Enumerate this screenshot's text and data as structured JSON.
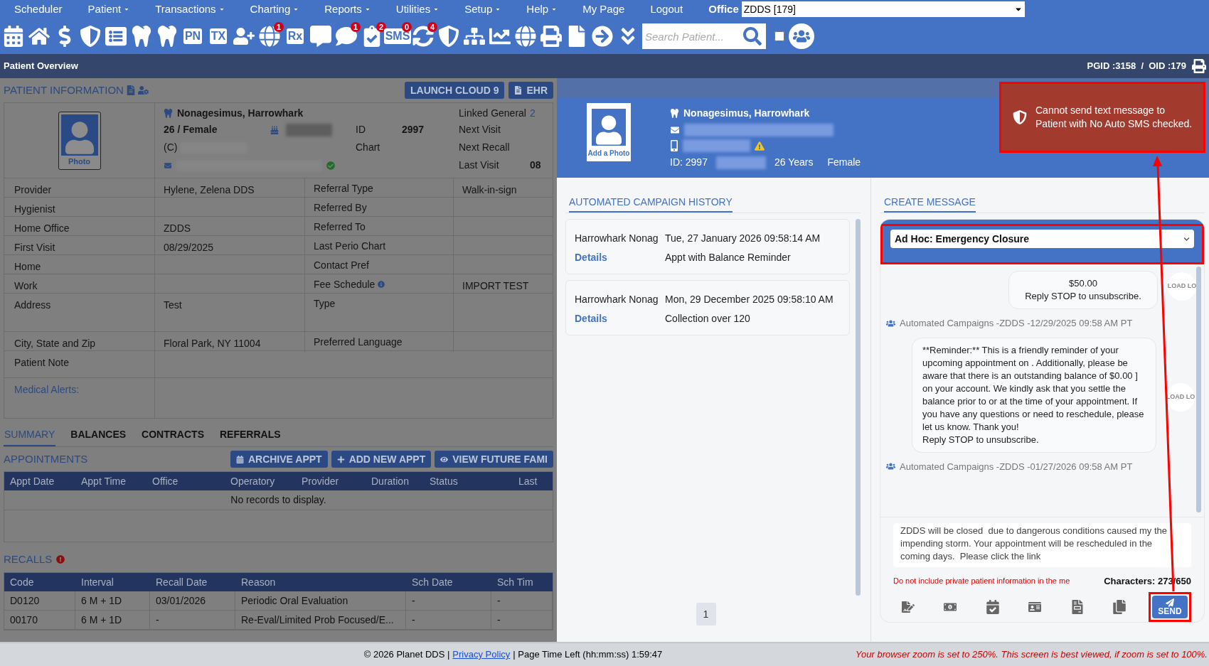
{
  "menu": {
    "items": [
      {
        "label": "Scheduler",
        "dropdown": false
      },
      {
        "label": "Patient",
        "dropdown": true
      },
      {
        "label": "Transactions",
        "dropdown": true
      },
      {
        "label": "Charting",
        "dropdown": true
      },
      {
        "label": "Reports",
        "dropdown": true
      },
      {
        "label": "Utilities",
        "dropdown": true
      },
      {
        "label": "Setup",
        "dropdown": true
      },
      {
        "label": "Help",
        "dropdown": true
      },
      {
        "label": "My Page",
        "dropdown": false
      },
      {
        "label": "Logout",
        "dropdown": false
      }
    ],
    "office_label": "Office",
    "office_value": "ZDDS [179]"
  },
  "toolbar": {
    "items": [
      {
        "kind": "icon"
      },
      {
        "kind": "icon"
      },
      {
        "kind": "icon"
      },
      {
        "kind": "icon"
      },
      {
        "kind": "icon"
      },
      {
        "kind": "icon"
      },
      {
        "kind": "icon"
      },
      {
        "kind": "text",
        "label": "PN"
      },
      {
        "kind": "text",
        "label": "TX"
      },
      {
        "kind": "icon"
      },
      {
        "kind": "icon",
        "badge": "1"
      },
      {
        "kind": "text",
        "label": "Rx"
      },
      {
        "kind": "icon"
      },
      {
        "kind": "icon",
        "badge": "1"
      },
      {
        "kind": "icon",
        "badge": "2"
      },
      {
        "kind": "text",
        "label": "SMS",
        "badge": "0"
      },
      {
        "kind": "icon",
        "badge": "4"
      },
      {
        "kind": "icon"
      },
      {
        "kind": "icon"
      },
      {
        "kind": "icon"
      },
      {
        "kind": "icon"
      },
      {
        "kind": "icon"
      },
      {
        "kind": "icon"
      },
      {
        "kind": "icon"
      },
      {
        "kind": "icon"
      }
    ],
    "search_placeholder": "Search Patient...",
    "checkbox_checked": false
  },
  "page_header": {
    "title": "Patient Overview",
    "ids": "PGID :3158  /  OID :179"
  },
  "patient_info": {
    "title": "PATIENT INFORMATION",
    "buttons": [
      "LAUNCH CLOUD 9",
      "EHR"
    ],
    "photo_label": "Photo",
    "name": "Nonagesimus, Harrowhark",
    "age_sex": "26 / Female",
    "phone_prefix": "(C)",
    "id_label": "ID",
    "id_value": "2997",
    "chart_label": "Chart",
    "side": [
      {
        "label": "Linked General",
        "value": "2"
      },
      {
        "label": "Next Visit"
      },
      {
        "label": "Next Recall"
      },
      {
        "label": "Last Visit",
        "value": "08"
      }
    ],
    "rows": [
      {
        "label": "Provider",
        "value": "Hylene, Zelena DDS",
        "label2": "Referral Type",
        "info": false,
        "value2": "Walk-in-sign",
        "tall": false
      },
      {
        "label": "Hygienist",
        "label2": "Referred By",
        "info": false,
        "tall": false
      },
      {
        "label": "Home Office",
        "value": "ZDDS",
        "label2": "Referred To",
        "info": false,
        "tall": false
      },
      {
        "label": "First Visit",
        "value": "08/29/2025",
        "label2": "Last Perio Chart",
        "info": false,
        "tall": false
      },
      {
        "label": "Home",
        "label2": "Contact Pref",
        "info": false,
        "tall": false
      },
      {
        "label": "Work",
        "label2": "Fee Schedule",
        "info": true,
        "value2": "IMPORT TEST",
        "tall": false
      },
      {
        "label": "Address",
        "value": "Test",
        "label2": "Type",
        "info": false,
        "tall": true
      },
      {
        "label": "City, State and Zip",
        "value": "Floral Park, NY 11004",
        "label2": "Preferred Language",
        "info": false,
        "tall": false
      }
    ],
    "patient_note_label": "Patient Note",
    "medical_alerts_label": "Medical Alerts:"
  },
  "tabs": [
    {
      "label": "SUMMARY",
      "selected": true
    },
    {
      "label": "BALANCES",
      "selected": false
    },
    {
      "label": "CONTRACTS",
      "selected": false
    },
    {
      "label": "REFERRALS",
      "selected": false
    }
  ],
  "appointments": {
    "title": "APPOINTMENTS",
    "buttons": [
      "ARCHIVE APPT",
      "ADD NEW APPT",
      "VIEW FUTURE FAMI"
    ],
    "columns": [
      "Appt Date",
      "Appt Time",
      "Office",
      "Operatory",
      "Provider",
      "Duration",
      "Status",
      "Last"
    ],
    "empty_message": "No records to display."
  },
  "recalls": {
    "title": "RECALLS",
    "columns": [
      "Code",
      "Interval",
      "Recall Date",
      "Reason",
      "Sch Date",
      "Sch Tim"
    ],
    "rows": [
      [
        "D0120",
        "6 M + 1D",
        "03/01/2026",
        "Periodic Oral Evaluation",
        "-",
        "-"
      ],
      [
        "00170",
        "6 M + 1D",
        "-",
        "Re-Eval/Limited Prob Focused/E...",
        "-",
        "-"
      ]
    ]
  },
  "modal": {
    "name": "Nonagesimus, Harrowhark",
    "photo_label": "Add a Photo",
    "id": "ID: 2997",
    "age": "26 Years",
    "sex": "Female",
    "history_title": "AUTOMATED CAMPAIGN HISTORY",
    "history": [
      {
        "name": "Harrowhark Nonag",
        "date": "Tue, 27 January 2026 09:58:14 AM",
        "link": "Details",
        "campaign": "Appt with Balance Reminder"
      },
      {
        "name": "Harrowhark Nonag",
        "date": "Mon, 29 December 2025 09:58:10 AM",
        "link": "Details",
        "campaign": "Collection over 120"
      }
    ],
    "pages": [
      {
        "label": "1",
        "selected": true
      }
    ],
    "create_title": "CREATE MESSAGE",
    "template": "Ad Hoc: Emergency Closure",
    "messages": [
      {
        "kind": "centered",
        "text": "$50.00\nReply STOP to unsubscribe.",
        "avatar": "LOAD LO",
        "meta": "Automated Campaigns -ZDDS -12/29/2025 09:58 AM PT"
      },
      {
        "kind": "left",
        "text": "   **Reminder:** This is a friendly reminder of your upcoming appointment on . Additionally, please be aware that there is an outstanding balance of $0.00 ] on your account.  We kindly ask that you settle the balance prior to or at the time of your appointment. If you have any questions or need to reschedule, please let us know. Thank you!\nReply STOP to unsubscribe.",
        "avatar": "LOAD LO",
        "meta": "Automated Campaigns -ZDDS -01/27/2026 09:58 AM PT"
      }
    ],
    "draft": "ZDDS will be closed  due to dangerous conditions caused my the impending storm. Your appointment will be rescheduled in the coming days.  Please click the link",
    "privacy_warning": "Do not include private patient information in the me",
    "characters": "Characters: 273/650",
    "send": "SEND"
  },
  "toast": "Cannot send text message to Patient with No Auto SMS checked.",
  "footer": {
    "copyright": "© 2026 Planet DDS |",
    "link": "Privacy Policy",
    "time": "| Page Time Left (hh:mm:ss) 1:59:47",
    "warning": "Your browser zoom is set to 250%. This screen is best viewed, if zoom is set to 100%."
  }
}
